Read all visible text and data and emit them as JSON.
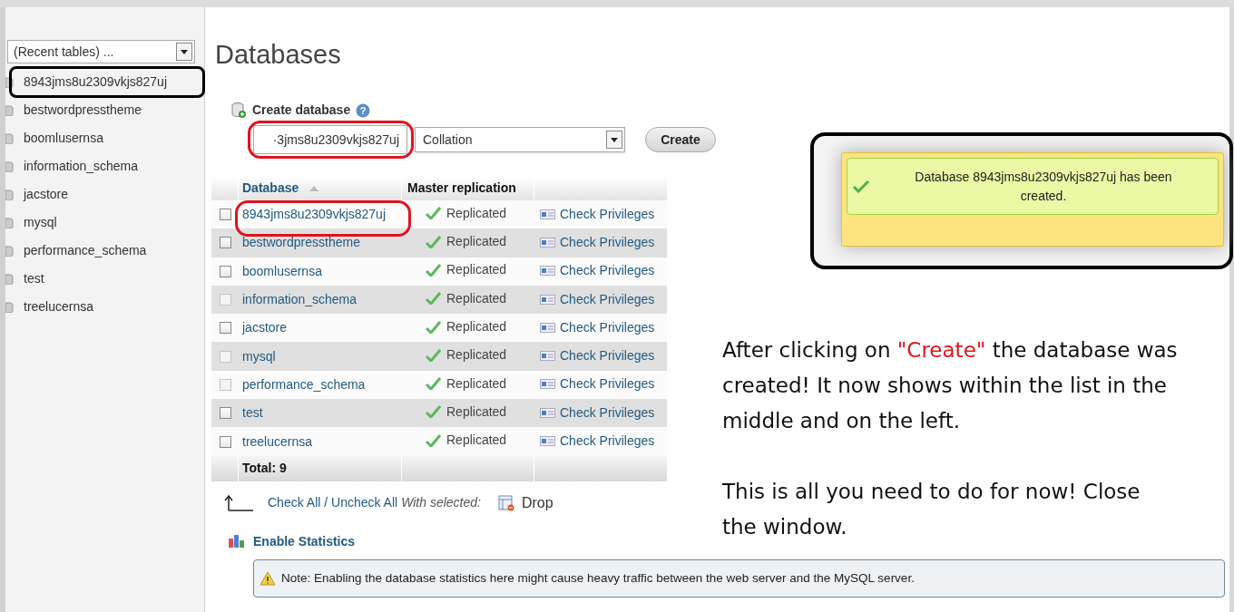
{
  "sidebar": {
    "recent_tables": "(Recent tables) ...",
    "databases": [
      {
        "name": "8943jms8u2309vkjs827uj",
        "circled": true
      },
      {
        "name": "bestwordpresstheme",
        "circled": false
      },
      {
        "name": "boomlusernsa",
        "circled": false
      },
      {
        "name": "information_schema",
        "circled": false
      },
      {
        "name": "jacstore",
        "circled": false
      },
      {
        "name": "mysql",
        "circled": false
      },
      {
        "name": "performance_schema",
        "circled": false
      },
      {
        "name": "test",
        "circled": false
      },
      {
        "name": "treelucernsa",
        "circled": false
      }
    ]
  },
  "main": {
    "title": "Databases",
    "create": {
      "label": "Create database",
      "help": "?",
      "name_value": "·3jms8u2309vkjs827uj",
      "name_circled": true,
      "collation": "Collation",
      "button": "Create"
    },
    "table": {
      "columns": [
        "Database",
        "Master replication"
      ],
      "rows": [
        {
          "name": "8943jms8u2309vkjs827uj",
          "checked": false,
          "disabled": false,
          "circled": true,
          "replication": "Replicated",
          "action": "Check Privileges"
        },
        {
          "name": "bestwordpresstheme",
          "checked": false,
          "disabled": false,
          "circled": false,
          "replication": "Replicated",
          "action": "Check Privileges"
        },
        {
          "name": "boomlusernsa",
          "checked": false,
          "disabled": false,
          "circled": false,
          "replication": "Replicated",
          "action": "Check Privileges"
        },
        {
          "name": "information_schema",
          "checked": false,
          "disabled": true,
          "circled": false,
          "replication": "Replicated",
          "action": "Check Privileges"
        },
        {
          "name": "jacstore",
          "checked": false,
          "disabled": false,
          "circled": false,
          "replication": "Replicated",
          "action": "Check Privileges"
        },
        {
          "name": "mysql",
          "checked": false,
          "disabled": true,
          "circled": false,
          "replication": "Replicated",
          "action": "Check Privileges"
        },
        {
          "name": "performance_schema",
          "checked": false,
          "disabled": true,
          "circled": false,
          "replication": "Replicated",
          "action": "Check Privileges"
        },
        {
          "name": "test",
          "checked": false,
          "disabled": false,
          "circled": false,
          "replication": "Replicated",
          "action": "Check Privileges"
        },
        {
          "name": "treelucernsa",
          "checked": false,
          "disabled": false,
          "circled": false,
          "replication": "Replicated",
          "action": "Check Privileges"
        }
      ],
      "total": "Total: 9"
    },
    "bulk": {
      "check_all": "Check All / Uncheck All",
      "with_selected": "With selected:",
      "drop": "Drop"
    },
    "statistics": {
      "link": "Enable Statistics",
      "note": "Note: Enabling the database statistics here might cause heavy traffic between the web server and the MySQL server."
    }
  },
  "notification": {
    "message": "Database 8943jms8u2309vkjs827uj has been created.",
    "circled": true
  },
  "annotation": {
    "paragraphs": [
      {
        "before": "After clicking on ",
        "highlight": "\"Create\"",
        "after": " the database was created! It now shows within the list in the middle and on the left."
      },
      {
        "before": "This is all you need to do for now! Close the window."
      }
    ]
  }
}
